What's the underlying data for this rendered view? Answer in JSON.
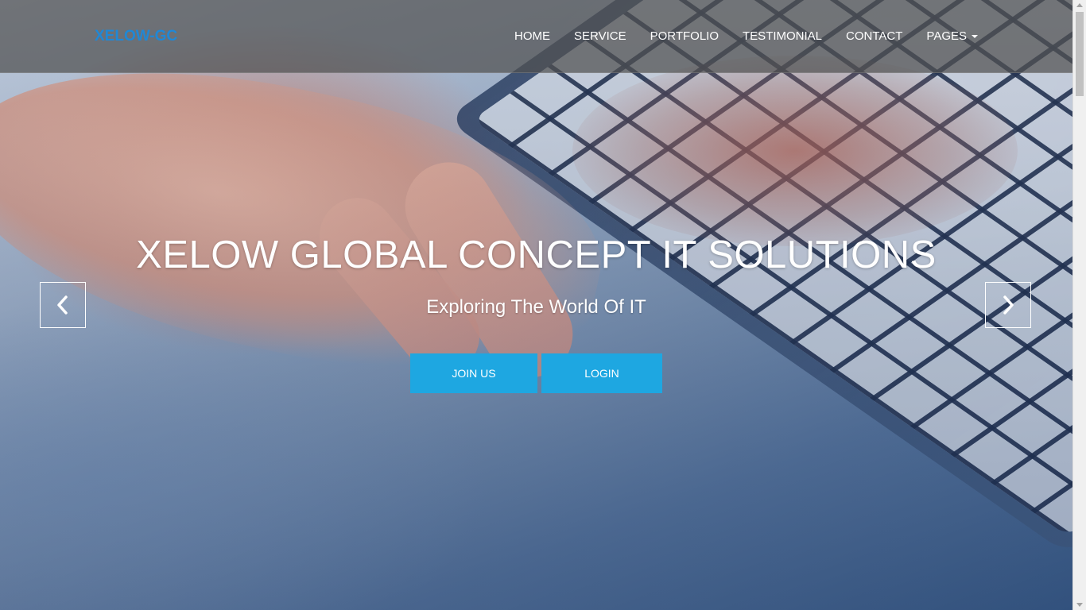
{
  "navbar": {
    "brand": "XELOW-GC",
    "items": [
      {
        "label": "HOME"
      },
      {
        "label": "SERVICE"
      },
      {
        "label": "PORTFOLIO"
      },
      {
        "label": "TESTIMONIAL"
      },
      {
        "label": "CONTACT"
      },
      {
        "label": "PAGES",
        "has_dropdown": true
      }
    ]
  },
  "hero": {
    "title": "XELOW GLOBAL CONCEPT IT SOLUTIONS",
    "subtitle": "Exploring The World Of IT",
    "buttons": {
      "join_label": "JOIN US",
      "login_label": "LOGIN"
    },
    "controls": {
      "prev_icon": "chevron-left-icon",
      "next_icon": "chevron-right-icon"
    }
  },
  "colors": {
    "brand": "#1f88d6",
    "button": "#1ea7e1",
    "navbar_bg": "rgba(80,80,80,0.72)",
    "text": "#ffffff"
  }
}
